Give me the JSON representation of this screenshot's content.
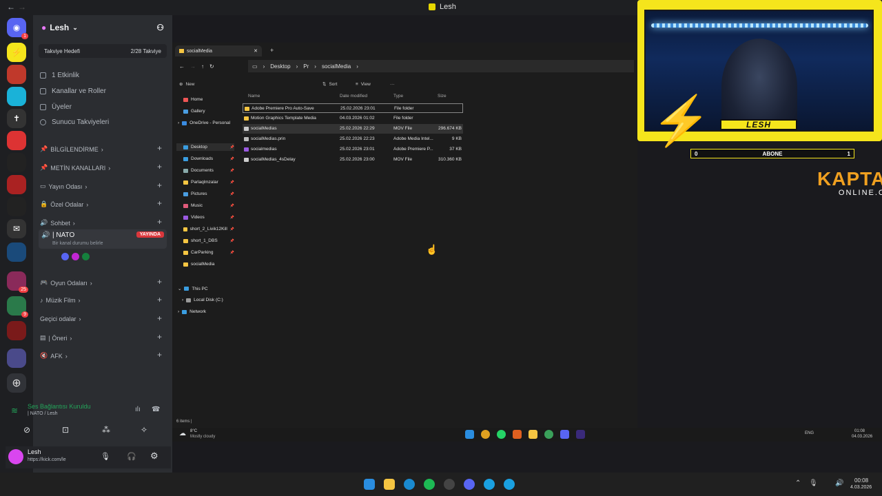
{
  "window": {
    "title": "Lesh",
    "back": "←",
    "forward": "→"
  },
  "server_rail": {
    "badges": [
      "1",
      "25",
      "9"
    ]
  },
  "discord": {
    "server_name": "Lesh",
    "boost": {
      "label": "Takviye Hedefi",
      "progress": "2/28 Takviye"
    },
    "menu": [
      "1 Etkinlik",
      "Kanallar ve Roller",
      "Üyeler",
      "Sunucu Takviyeleri"
    ],
    "categories": [
      "BİLGİLENDİRME",
      "METİN KANALLARI",
      "Yayın Odası",
      "Özel Odalar"
    ],
    "voice_channel": {
      "name": "Sohbet"
    },
    "active_channel": {
      "name": "| NATO",
      "status": "Bir kanal durumu belirle",
      "live_badge": "YAYINDA"
    },
    "categories2": [
      "Oyun Odaları",
      "Müzik Film",
      "Geçici odalar",
      "| Öneri",
      "AFK"
    ],
    "voice_connection": {
      "status": "Ses Bağlantısı Kuruldu",
      "channel": "| NATO / Lesh"
    },
    "user": {
      "name": "Lesh",
      "status": "https://kick.com/le"
    }
  },
  "explorer": {
    "tab_title": "socialMedia",
    "breadcrumb": [
      "Desktop",
      "Pr",
      "socialMedia"
    ],
    "toolbar": {
      "new": "New",
      "sort": "Sort",
      "view": "View",
      "more": "···"
    },
    "nav": [
      "Home",
      "Gallery",
      "OneDrive - Personal",
      "Desktop",
      "Downloads",
      "Documents",
      "Parlaqlmzalar",
      "Pictures",
      "Music",
      "Videos",
      "short_2_Livik12Kill",
      "short_1_DBS",
      "CarParking",
      "socialMedia",
      "This PC",
      "Local Disk (C:)",
      "Network"
    ],
    "columns": {
      "name": "Name",
      "date": "Date modified",
      "type": "Type",
      "size": "Size"
    },
    "files": [
      {
        "name": "Adobe Premiere Pro Auto-Save",
        "date": "25.02.2026 23:01",
        "type": "File folder",
        "size": ""
      },
      {
        "name": "Motion Graphics Template Media",
        "date": "04.03.2026 01:02",
        "type": "File folder",
        "size": ""
      },
      {
        "name": "socialMedias",
        "date": "25.02.2026 22:29",
        "type": "MOV File",
        "size": "296.674 KB"
      },
      {
        "name": "socialMedias.prin",
        "date": "25.02.2026 22:23",
        "type": "Adobe Media Intel...",
        "size": "9 KB"
      },
      {
        "name": "socialmedias",
        "date": "25.02.2026 23:01",
        "type": "Adobe Premiere P...",
        "size": "37 KB"
      },
      {
        "name": "socialMedias_4sDelay",
        "date": "25.02.2026 23:00",
        "type": "MOV File",
        "size": "310.360 KB"
      }
    ],
    "status": "6 items  |"
  },
  "inner_taskbar": {
    "weather_temp": "8°C",
    "weather_desc": "Mostly cloudy",
    "lang": "ENG",
    "time": "01:08",
    "date": "04.03.2026"
  },
  "overlay": {
    "name": "LESH",
    "abone_label": "ABONE",
    "abone_current": "0",
    "abone_goal": "1",
    "logo_top": "KAPTAN",
    "logo_bottom": "ONLINE.COM"
  },
  "outer_taskbar": {
    "time": "00:08",
    "date": "4.03.2026"
  },
  "colors": {
    "discord_bg": "#2b2d31",
    "rail_bg": "#1e1f22",
    "live_red": "#da373c",
    "overlay_yellow": "#f5e51c",
    "explorer_bg": "#1c1c1c"
  }
}
